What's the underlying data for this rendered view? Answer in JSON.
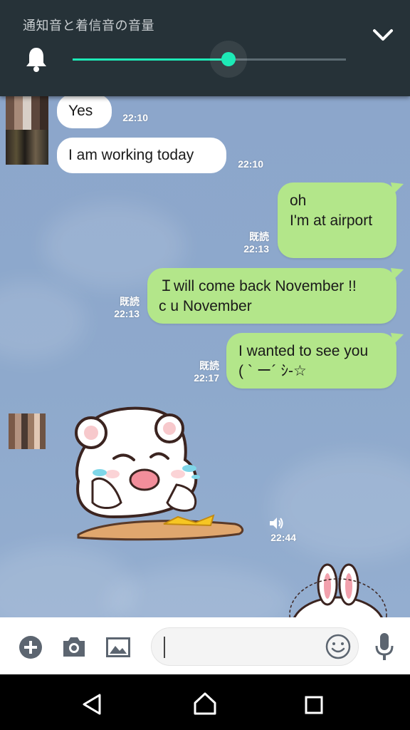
{
  "volume_panel": {
    "title": "通知音と着信音の音量",
    "level": 0.57,
    "icon": "bell-icon",
    "collapse_icon": "chevron-down-icon"
  },
  "messages": [
    {
      "side": "in",
      "text": "Yes",
      "time": "22:10"
    },
    {
      "side": "in",
      "text": "I am working today",
      "time": "22:10"
    },
    {
      "side": "out",
      "text": "oh\nI'm at airport",
      "read": "既読",
      "time": "22:13"
    },
    {
      "side": "out",
      "text": "Ｉwill come back November !!\nc u November",
      "read": "既読",
      "time": "22:13"
    },
    {
      "side": "out",
      "text": "I wanted to see you\n( ` ー´ ｼ-☆",
      "read": "既読",
      "time": "22:17"
    },
    {
      "side": "in",
      "type": "sticker",
      "sound_icon": "speaker-icon",
      "time": "22:44"
    }
  ],
  "input_bar": {
    "icons": [
      "plus-icon",
      "camera-icon",
      "image-icon",
      "emoji-icon",
      "microphone-icon"
    ],
    "placeholder": ""
  },
  "nav_bar": {
    "icons": [
      "back-icon",
      "home-icon",
      "recents-icon"
    ]
  },
  "colors": {
    "accent": "#1de9b6",
    "panel": "#263238",
    "outgoing_bubble": "#b3e68a",
    "incoming_bubble": "#ffffff",
    "chat_background": "#8ea6c9"
  }
}
